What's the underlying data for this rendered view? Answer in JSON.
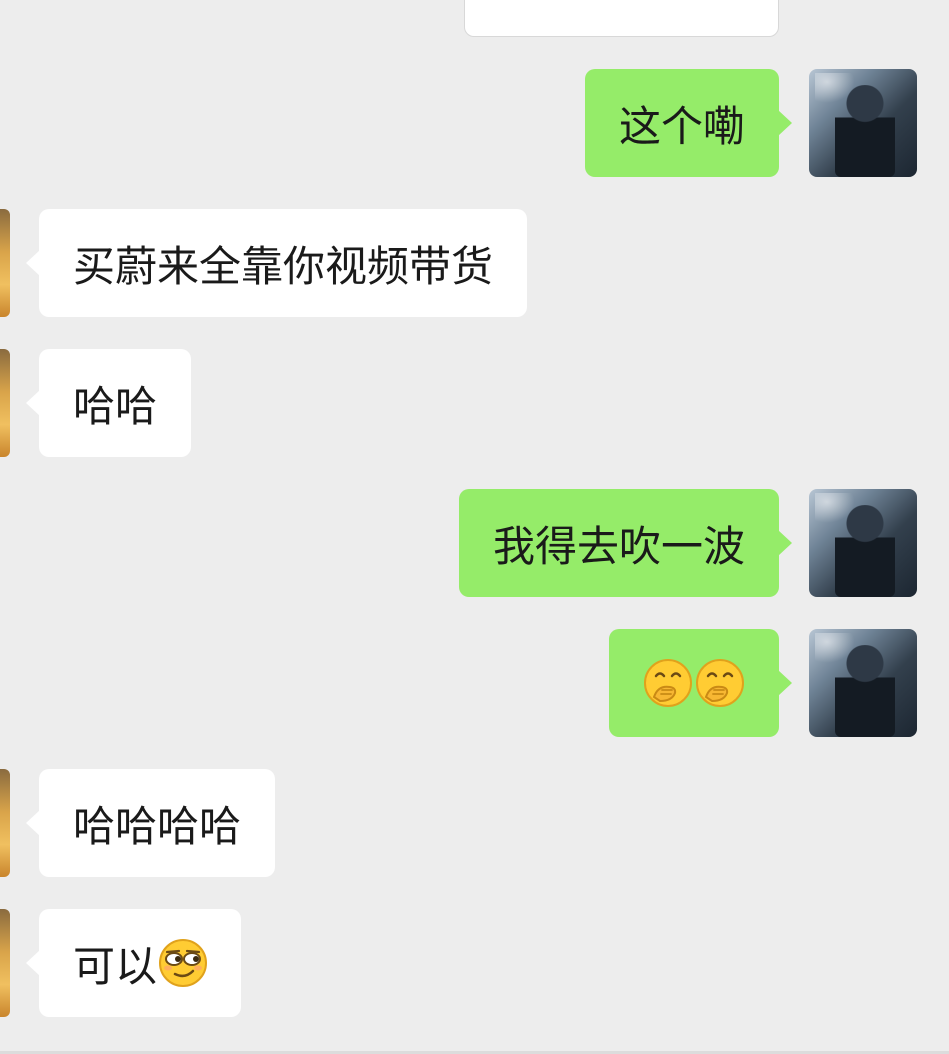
{
  "chat": {
    "messages": [
      {
        "side": "out",
        "text": "这个嘞"
      },
      {
        "side": "in",
        "text": "买蔚来全靠你视频带货"
      },
      {
        "side": "in",
        "text": "哈哈"
      },
      {
        "side": "out",
        "text": "我得去吹一波"
      },
      {
        "side": "out",
        "emoji": [
          "covering-mouth-emoji",
          "covering-mouth-emoji"
        ]
      },
      {
        "side": "in",
        "text": "哈哈哈哈"
      },
      {
        "side": "in",
        "text": "可以",
        "emoji": [
          "smirk-emoji"
        ]
      }
    ]
  },
  "colors": {
    "background": "#ededed",
    "outgoing_bubble": "#95ec69",
    "incoming_bubble": "#ffffff",
    "text": "#1a1a1a"
  },
  "icons": {
    "self_avatar": "user-photo-avatar",
    "other_avatar": "contact-avatar",
    "emoji_a": "covering-mouth-emoji",
    "emoji_b": "smirk-emoji"
  }
}
